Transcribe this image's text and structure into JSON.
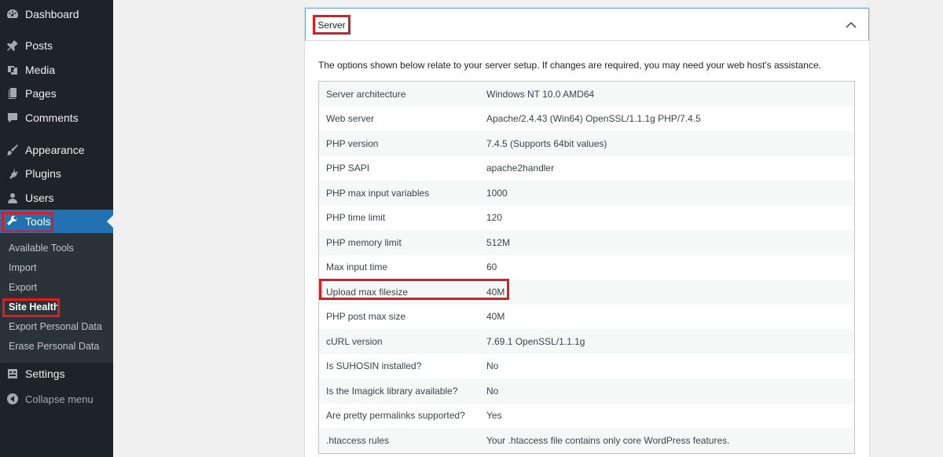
{
  "sidebar": {
    "items": [
      {
        "label": "Dashboard",
        "icon": "dashboard-icon"
      },
      {
        "label": "Posts",
        "icon": "pin-icon"
      },
      {
        "label": "Media",
        "icon": "media-icon"
      },
      {
        "label": "Pages",
        "icon": "page-icon"
      },
      {
        "label": "Comments",
        "icon": "comment-icon"
      },
      {
        "label": "Appearance",
        "icon": "brush-icon"
      },
      {
        "label": "Plugins",
        "icon": "plugin-icon"
      },
      {
        "label": "Users",
        "icon": "user-icon"
      },
      {
        "label": "Tools",
        "icon": "wrench-icon"
      },
      {
        "label": "Settings",
        "icon": "settings-icon"
      }
    ],
    "submenu": [
      "Available Tools",
      "Import",
      "Export",
      "Site Health",
      "Export Personal Data",
      "Erase Personal Data"
    ],
    "collapse_label": "Collapse menu",
    "active_color": "#2271b1"
  },
  "panel": {
    "title": "Server",
    "intro": "The options shown below relate to your server setup. If changes are required, you may need your web host's assistance.",
    "rows": [
      {
        "label": "Server architecture",
        "value": "Windows NT 10.0 AMD64"
      },
      {
        "label": "Web server",
        "value": "Apache/2.4.43 (Win64) OpenSSL/1.1.1g PHP/7.4.5"
      },
      {
        "label": "PHP version",
        "value": "7.4.5 (Supports 64bit values)"
      },
      {
        "label": "PHP SAPI",
        "value": "apache2handler"
      },
      {
        "label": "PHP max input variables",
        "value": "1000"
      },
      {
        "label": "PHP time limit",
        "value": "120"
      },
      {
        "label": "PHP memory limit",
        "value": "512M"
      },
      {
        "label": "Max input time",
        "value": "60"
      },
      {
        "label": "Upload max filesize",
        "value": "40M"
      },
      {
        "label": "PHP post max size",
        "value": "40M"
      },
      {
        "label": "cURL version",
        "value": "7.69.1 OpenSSL/1.1.1g"
      },
      {
        "label": "Is SUHOSIN installed?",
        "value": "No"
      },
      {
        "label": "Is the Imagick library available?",
        "value": "No"
      },
      {
        "label": "Are pretty permalinks supported?",
        "value": "Yes"
      },
      {
        "label": ".htaccess rules",
        "value": "Your .htaccess file contains only core WordPress features."
      }
    ]
  },
  "highlight_color": "#e01b24"
}
